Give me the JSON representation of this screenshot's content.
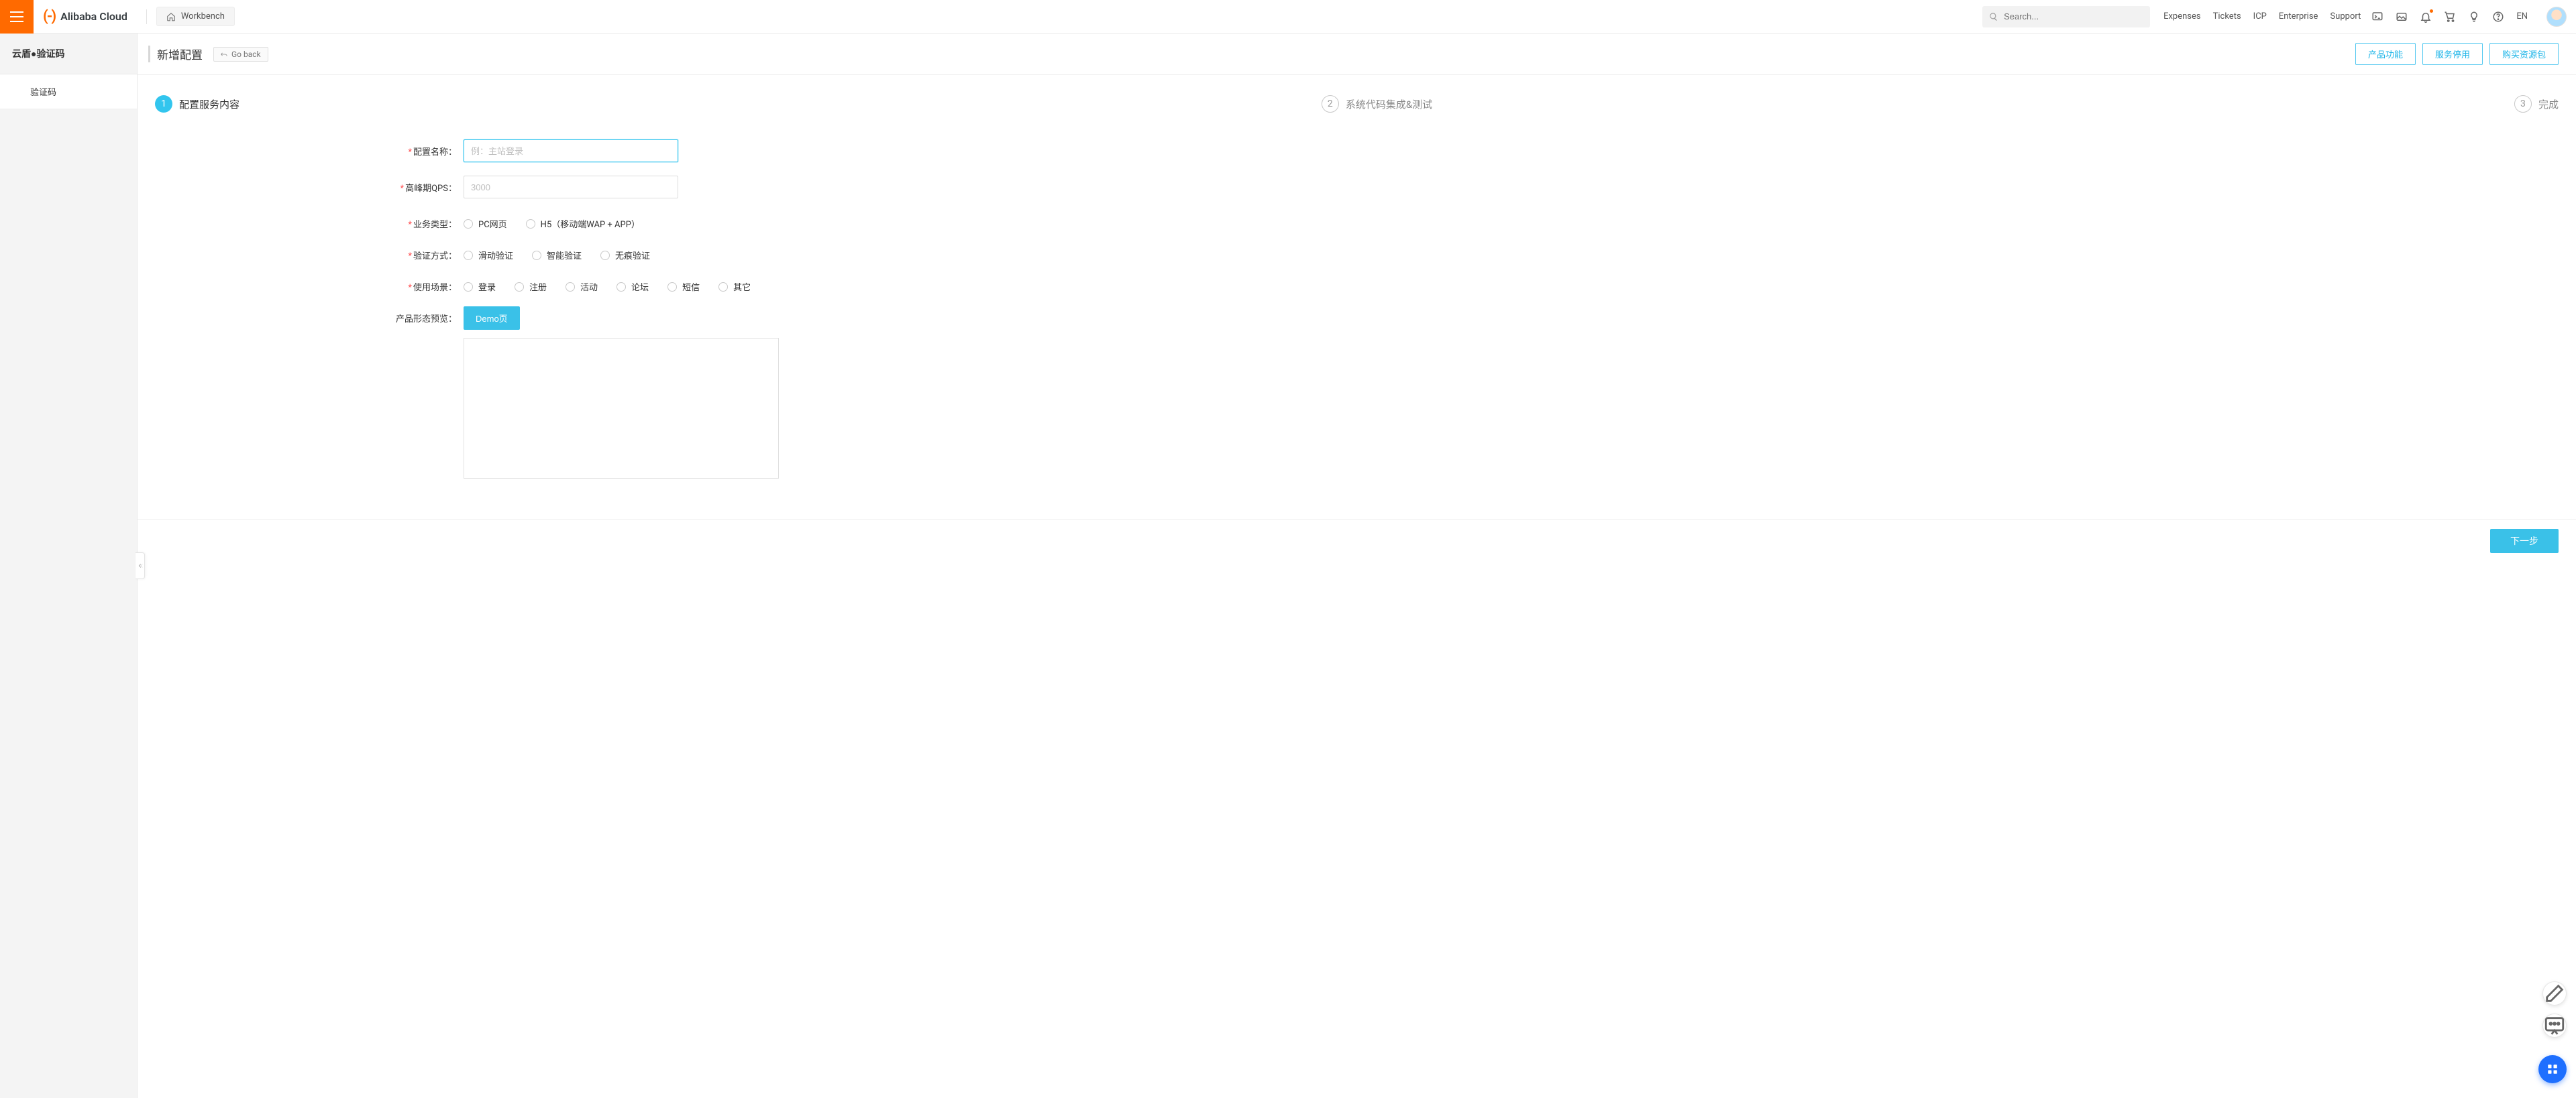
{
  "header": {
    "brand": "Alibaba Cloud",
    "workbench": "Workbench",
    "search_placeholder": "Search...",
    "nav": {
      "expenses": "Expenses",
      "tickets": "Tickets",
      "icp": "ICP",
      "enterprise": "Enterprise",
      "support": "Support"
    },
    "lang": "EN"
  },
  "sidebar": {
    "title": "云盾●验证码",
    "items": [
      {
        "label": "验证码"
      }
    ]
  },
  "page": {
    "title": "新增配置",
    "goback": "Go back",
    "buttons": {
      "features": "产品功能",
      "deprecate": "服务停用",
      "buy": "购买资源包"
    }
  },
  "steps": [
    {
      "num": "1",
      "label": "配置服务内容",
      "active": true
    },
    {
      "num": "2",
      "label": "系统代码集成&测试",
      "active": false
    },
    {
      "num": "3",
      "label": "完成",
      "active": false
    }
  ],
  "form": {
    "config_name": {
      "label": "配置名称",
      "placeholder": "例：主站登录",
      "value": ""
    },
    "peak_qps": {
      "label": "高峰期QPS",
      "placeholder": "3000",
      "value": ""
    },
    "biz_type": {
      "label": "业务类型",
      "options": [
        "PC网页",
        "H5（移动端WAP + APP）"
      ]
    },
    "verify_mode": {
      "label": "验证方式",
      "options": [
        "滑动验证",
        "智能验证",
        "无痕验证"
      ]
    },
    "scene": {
      "label": "使用场景",
      "options": [
        "登录",
        "注册",
        "活动",
        "论坛",
        "短信",
        "其它"
      ]
    },
    "preview": {
      "label": "产品形态预览",
      "demo_btn": "Demo页"
    }
  },
  "footer": {
    "next": "下一步"
  }
}
